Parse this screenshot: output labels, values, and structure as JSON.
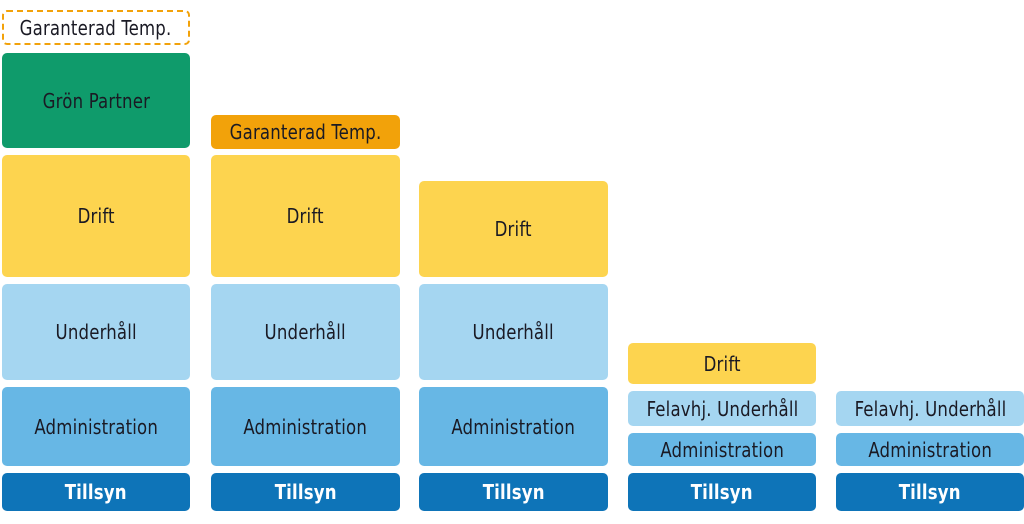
{
  "diagram": {
    "type": "stacked service tiers",
    "colors": {
      "tillsyn": "#0e74b8",
      "administration": "#67b7e5",
      "underhall": "#a5d6f1",
      "drift": "#fdd44f",
      "gron_partner": "#0f9b6b",
      "garanterad_temp": "#f2a20a"
    },
    "columns": [
      {
        "blocks": [
          {
            "label": "Garanterad Temp.",
            "style": "optional-dashed"
          },
          {
            "label": "Grön Partner"
          },
          {
            "label": "Drift"
          },
          {
            "label": "Underhåll"
          },
          {
            "label": "Administration"
          },
          {
            "label": "Tillsyn"
          }
        ]
      },
      {
        "blocks": [
          {
            "label": "Garanterad Temp."
          },
          {
            "label": "Drift"
          },
          {
            "label": "Underhåll"
          },
          {
            "label": "Administration"
          },
          {
            "label": "Tillsyn"
          }
        ]
      },
      {
        "blocks": [
          {
            "label": "Drift"
          },
          {
            "label": "Underhåll"
          },
          {
            "label": "Administration"
          },
          {
            "label": "Tillsyn"
          }
        ]
      },
      {
        "blocks": [
          {
            "label": "Drift"
          },
          {
            "label": "Felavhj. Underhåll"
          },
          {
            "label": "Administration"
          },
          {
            "label": "Tillsyn"
          }
        ]
      },
      {
        "blocks": [
          {
            "label": "Felavhj. Underhåll"
          },
          {
            "label": "Administration"
          },
          {
            "label": "Tillsyn"
          }
        ]
      }
    ]
  }
}
